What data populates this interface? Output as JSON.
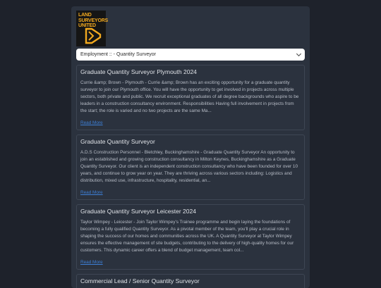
{
  "logo": {
    "line1": "LAND",
    "line2": "SURVEYORS",
    "line3": "UNITED"
  },
  "filter": {
    "value": "Employment :: - Quantity Surveyor"
  },
  "read_more_label": "Read More",
  "jobs": [
    {
      "title": "Graduate Quantity Surveyor Plymouth 2024",
      "desc": "Currie &amp; Brown - Plymouth - Currie &amp; Brown has an exciting opportunity for a graduate quantity surveyor to join our Plymouth office. You will have the opportunity to get involved in projects across multiple sectors, both private and public. We recruit exceptional graduates of all degree backgrounds who aspire to be leaders in a construction consultancy environment. Responsibilities Having full involvement in projects from the start; the role is varied and no two projects are the same Ma..."
    },
    {
      "title": "Graduate Quantity Surveyor",
      "desc": "A.D.S Construction Personnel - Bletchley, Buckinghamshire - Graduate Quantity Surveyor An opportunity to join an established and growing construction consultancy in Milton Keynes, Buckinghamshire as a Graduate Quantity Surveyor. Our client is an independent construction consultancy who have been founded for over 10 years, and continue to grow year on year. They are thriving across various sectors including: Logistics and distribution, mixed use, infrastructure, hospitality, residential, an..."
    },
    {
      "title": "Graduate Quantity Surveyor Leicester 2024",
      "desc": "Taylor Wimpey - Leicester - Join Taylor Wimpey's Trainee programme and begin laying the foundations of becoming a fully qualified Quantity Surveyor. As a pivotal member of the team, you'll play a crucial role in shaping the success of our homes and communities across the UK. A Quantity Surveyor at Taylor Wimpey ensures the effective management of site budgets, contributing to the delivery of high-quality homes for our customers. This dynamic career offers a blend of budget management, team col..."
    },
    {
      "title": "Commercial Lead / Senior Quantity Surveyor",
      "desc": ""
    }
  ]
}
